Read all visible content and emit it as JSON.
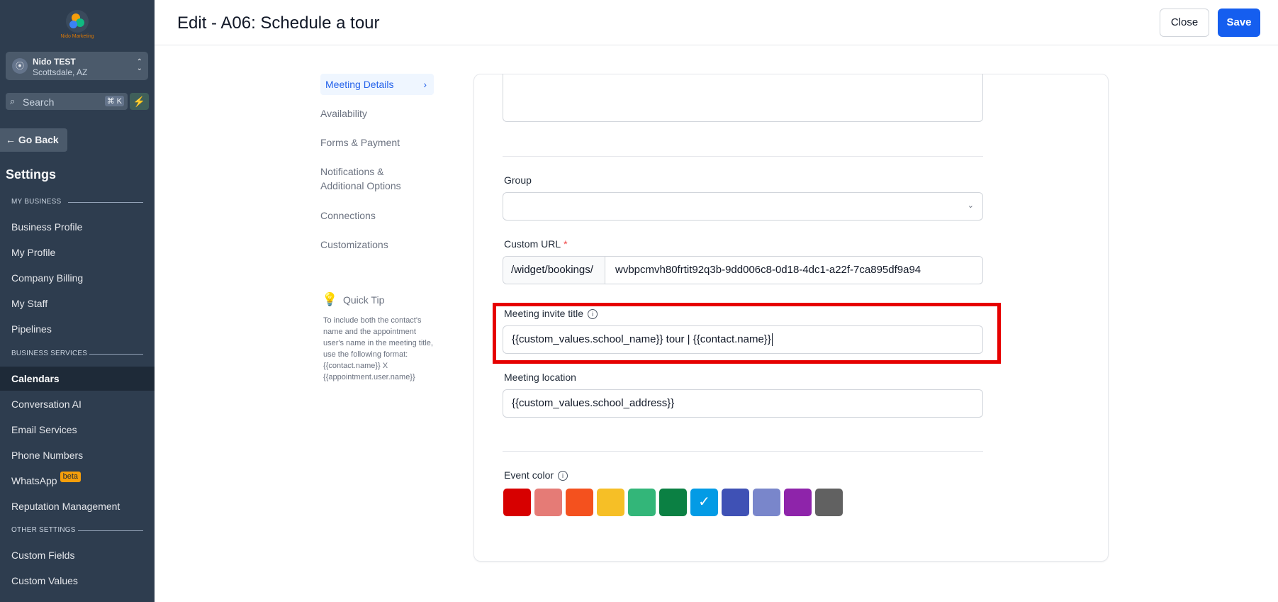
{
  "sidebar": {
    "logo_text": "Nido Marketing",
    "account": {
      "name": "Nido TEST",
      "location": "Scottsdale, AZ"
    },
    "search": {
      "placeholder": "Search",
      "shortcut": "⌘ K"
    },
    "go_back_label": "Go Back",
    "settings_title": "Settings",
    "sections": {
      "my_business": "MY BUSINESS",
      "business_services": "BUSINESS SERVICES",
      "other_settings": "OTHER SETTINGS"
    },
    "items": [
      {
        "label": "Business Profile"
      },
      {
        "label": "My Profile"
      },
      {
        "label": "Company Billing"
      },
      {
        "label": "My Staff"
      },
      {
        "label": "Pipelines"
      },
      {
        "label": "Calendars"
      },
      {
        "label": "Conversation AI"
      },
      {
        "label": "Email Services"
      },
      {
        "label": "Phone Numbers"
      },
      {
        "label": "WhatsApp",
        "badge": "beta"
      },
      {
        "label": "Reputation Management"
      },
      {
        "label": "Custom Fields"
      },
      {
        "label": "Custom Values"
      }
    ],
    "active_item": "Calendars"
  },
  "header": {
    "title": "Edit - A06: Schedule a tour",
    "close_label": "Close",
    "save_label": "Save"
  },
  "subnav": {
    "items": [
      {
        "label": "Meeting Details"
      },
      {
        "label": "Availability"
      },
      {
        "label": "Forms & Payment"
      },
      {
        "label": "Notifications & Additional Options"
      },
      {
        "label": "Connections"
      },
      {
        "label": "Customizations"
      }
    ],
    "active": "Meeting Details"
  },
  "quick_tip": {
    "title": "Quick Tip",
    "body": "To include both the contact's name and the appointment user's name in the meeting title, use the following format: {{contact.name}} X {{appointment.user.name}}"
  },
  "form": {
    "group": {
      "label": "Group",
      "value": ""
    },
    "custom_url": {
      "label": "Custom URL",
      "required_mark": "*",
      "prefix": "/widget/bookings/",
      "value": "wvbpcmvh80frtit92q3b-9dd006c8-0d18-4dc1-a22f-7ca895df9a94"
    },
    "meeting_invite_title": {
      "label": "Meeting invite title",
      "value": "{{custom_values.school_name}} tour | {{contact.name}}"
    },
    "meeting_location": {
      "label": "Meeting location",
      "value": "{{custom_values.school_address}}"
    },
    "event_color": {
      "label": "Event color",
      "swatches": [
        "#d70000",
        "#e57b76",
        "#f4511e",
        "#f6bf26",
        "#33b679",
        "#0b8043",
        "#039be5",
        "#3f51b5",
        "#7986cb",
        "#8e24aa",
        "#616161"
      ],
      "selected_index": 6
    }
  },
  "colors": {
    "sidebar_bg": "#2e3d4f",
    "primary": "#155eef",
    "highlight": "#e60000"
  }
}
